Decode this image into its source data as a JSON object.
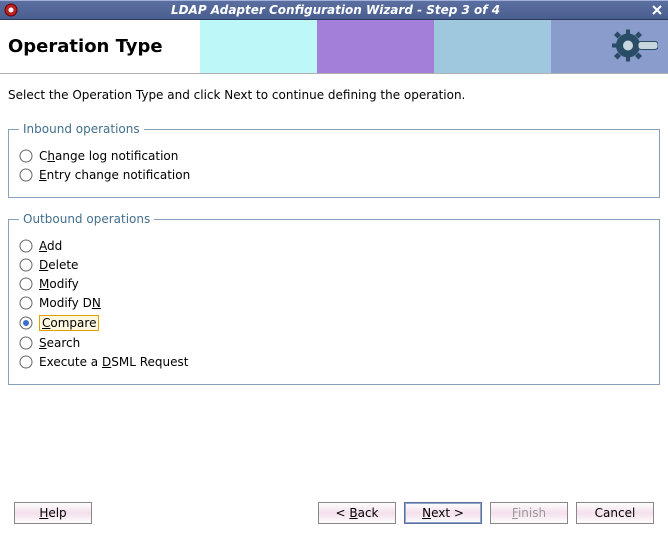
{
  "window": {
    "title": "LDAP Adapter Configuration Wizard - Step 3 of 4"
  },
  "header": {
    "title": "Operation Type"
  },
  "instruction": "Select the Operation Type and click Next to continue defining the operation.",
  "inbound": {
    "legend": "Inbound operations",
    "options": [
      {
        "pre": "C",
        "mnemonic": "h",
        "post": "ange log notification",
        "selected": false
      },
      {
        "pre": "",
        "mnemonic": "E",
        "post": "ntry change notification",
        "selected": false
      }
    ]
  },
  "outbound": {
    "legend": "Outbound operations",
    "options": [
      {
        "pre": "",
        "mnemonic": "A",
        "post": "dd",
        "selected": false,
        "focused": false
      },
      {
        "pre": "",
        "mnemonic": "D",
        "post": "elete",
        "selected": false,
        "focused": false
      },
      {
        "pre": "",
        "mnemonic": "M",
        "post": "odify",
        "selected": false,
        "focused": false
      },
      {
        "pre": "Modify D",
        "mnemonic": "N",
        "post": "",
        "selected": false,
        "focused": false
      },
      {
        "pre": "",
        "mnemonic": "C",
        "post": "ompare",
        "selected": true,
        "focused": true
      },
      {
        "pre": "",
        "mnemonic": "S",
        "post": "earch",
        "selected": false,
        "focused": false
      },
      {
        "pre": "Execute a ",
        "mnemonic": "D",
        "post": "SML Request",
        "selected": false,
        "focused": false
      }
    ]
  },
  "buttons": {
    "help": {
      "pre": "",
      "mnemonic": "H",
      "post": "elp"
    },
    "back": {
      "pre": "< ",
      "mnemonic": "B",
      "post": "ack"
    },
    "next": {
      "pre": "",
      "mnemonic": "N",
      "post": "ext >"
    },
    "finish": {
      "pre": "",
      "mnemonic": "F",
      "post": "inish"
    },
    "cancel": "Cancel"
  }
}
